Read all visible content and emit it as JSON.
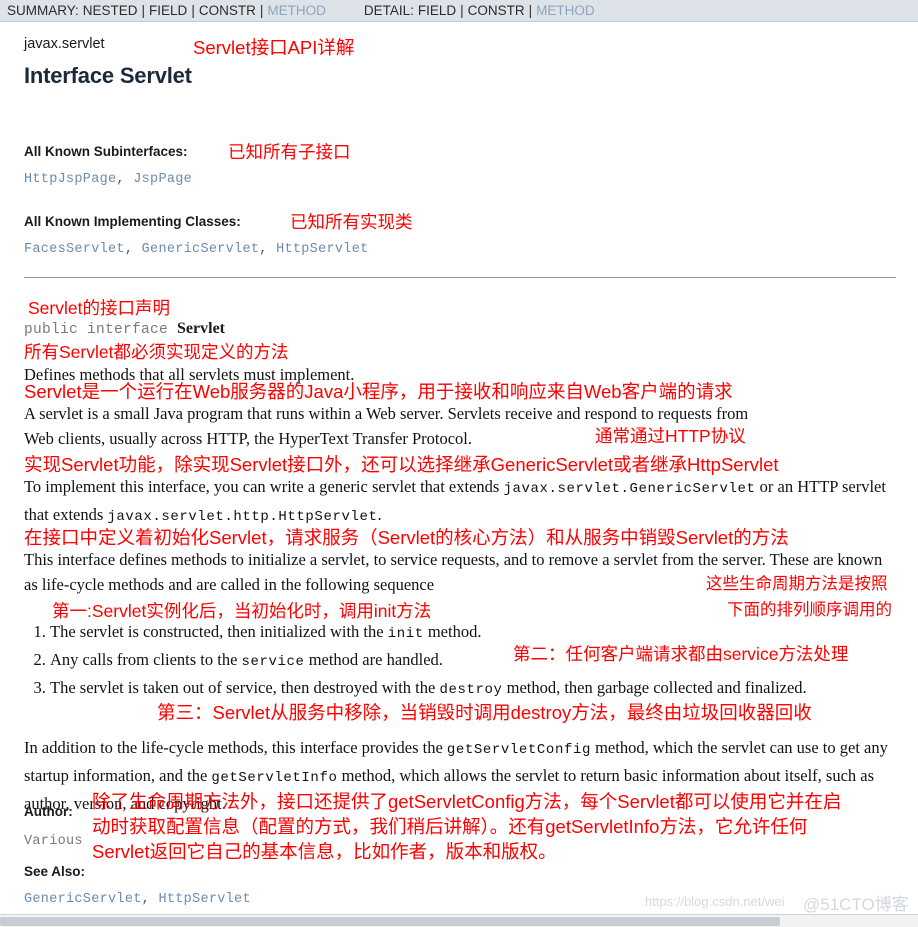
{
  "navbar": {
    "summary_label": "SUMMARY:",
    "summary_items": [
      "NESTED",
      "FIELD",
      "CONSTR",
      "METHOD"
    ],
    "summary_link_index": 3,
    "detail_label": "DETAIL:",
    "detail_items": [
      "FIELD",
      "CONSTR",
      "METHOD"
    ],
    "detail_link_index": 2,
    "separator": "|"
  },
  "header": {
    "package": "javax.servlet",
    "title": "Interface Servlet",
    "title_annotation": "Servlet接口API详解"
  },
  "subinterfaces": {
    "heading": "All Known Subinterfaces:",
    "annotation": "已知所有子接口",
    "items": [
      "HttpJspPage",
      "JspPage"
    ]
  },
  "implementing": {
    "heading": "All Known Implementing Classes:",
    "annotation": "已知所有实现类",
    "items": [
      "FacesServlet",
      "GenericServlet",
      "HttpServlet"
    ]
  },
  "declaration": {
    "annotation": "Servlet的接口声明",
    "modifiers": "public interface ",
    "name": "Servlet"
  },
  "body": {
    "summary_annotation": "所有Servlet都必须实现定义的方法",
    "summary": "Defines methods that all servlets must implement.",
    "para1_annotation": "Servlet是一个运行在Web服务器的Java小程序，用于接收和响应来自Web客户端的请求",
    "para1_line1": "A servlet is a small Java program that runs within a Web server. Servlets receive and respond to requests from",
    "para1_line2": "Web clients, usually across HTTP, the HyperText Transfer Protocol.",
    "para1_trailing_annotation": "通常通过HTTP协议",
    "para2_annotation": "实现Servlet功能，除实现Servlet接口外，还可以选择继承GenericServlet或者继承HttpServlet",
    "para2_a": "To implement this interface, you can write a generic servlet that extends ",
    "para2_code1": "javax.servlet.GenericServlet",
    "para2_b": " or an HTTP servlet that extends ",
    "para2_code2": "javax.servlet.http.HttpServlet",
    "para2_c": ".",
    "para3_annotation": "在接口中定义着初始化Servlet，请求服务（Servlet的核心方法）和从服务中销毁Servlet的方法",
    "para3": "This interface defines methods to initialize a servlet, to service requests, and to remove a servlet from the server. These are known as life-cycle methods and are called in the following sequence",
    "para3_trailing_annotation_line1": "这些生命周期方法是按照",
    "para3_trailing_annotation_line2": "下面的排列顺序调用的",
    "list_item1_annotation": "第一:Servlet实例化后，当初始化时，调用init方法",
    "list_item1_a": "The servlet is constructed, then initialized with the ",
    "list_item1_code": "init",
    "list_item1_b": " method.",
    "list_item2_a": "Any calls from clients to the ",
    "list_item2_code": "service",
    "list_item2_b": " method are handled.",
    "list_item2_annotation": "第二：任何客户端请求都由service方法处理",
    "list_item3_a": "The servlet is taken out of service, then destroyed with the ",
    "list_item3_code": "destroy",
    "list_item3_b": " method, then garbage collected and finalized.",
    "list_item3_annotation": "第三：Servlet从服务中移除，当销毁时调用destroy方法，最终由垃圾回收器回收",
    "para4_a": "In addition to the life-cycle methods, this interface provides the ",
    "para4_code1": "getServletConfig",
    "para4_b": " method, which the servlet can use to get any startup information, and the ",
    "para4_code2": "getServletInfo",
    "para4_c": " method, which allows the servlet to return basic information about itself, such as author, version, and copyright."
  },
  "author": {
    "heading": "Author:",
    "value": "Various",
    "annotation_line1": "除了生命周期方法外，接口还提供了getServletConfig方法，每个Servlet都可以使用它并在启",
    "annotation_line2": "动时获取配置信息（配置的方式，我们稍后讲解）。还有getServletInfo方法，它允许任何",
    "annotation_line3": "Servlet返回它自己的基本信息，比如作者，版本和版权。"
  },
  "see_also": {
    "heading": "See Also:",
    "items": [
      "GenericServlet",
      "HttpServlet"
    ]
  },
  "watermark": {
    "url": "https://blog.csdn.net/wei",
    "brand": "@51CTO博客"
  },
  "colors": {
    "annotation_red": "#ff0000",
    "navbar_bg": "#dee3e9",
    "link_blue": "#6b8bb0",
    "nav_link": "#8da3bd"
  }
}
